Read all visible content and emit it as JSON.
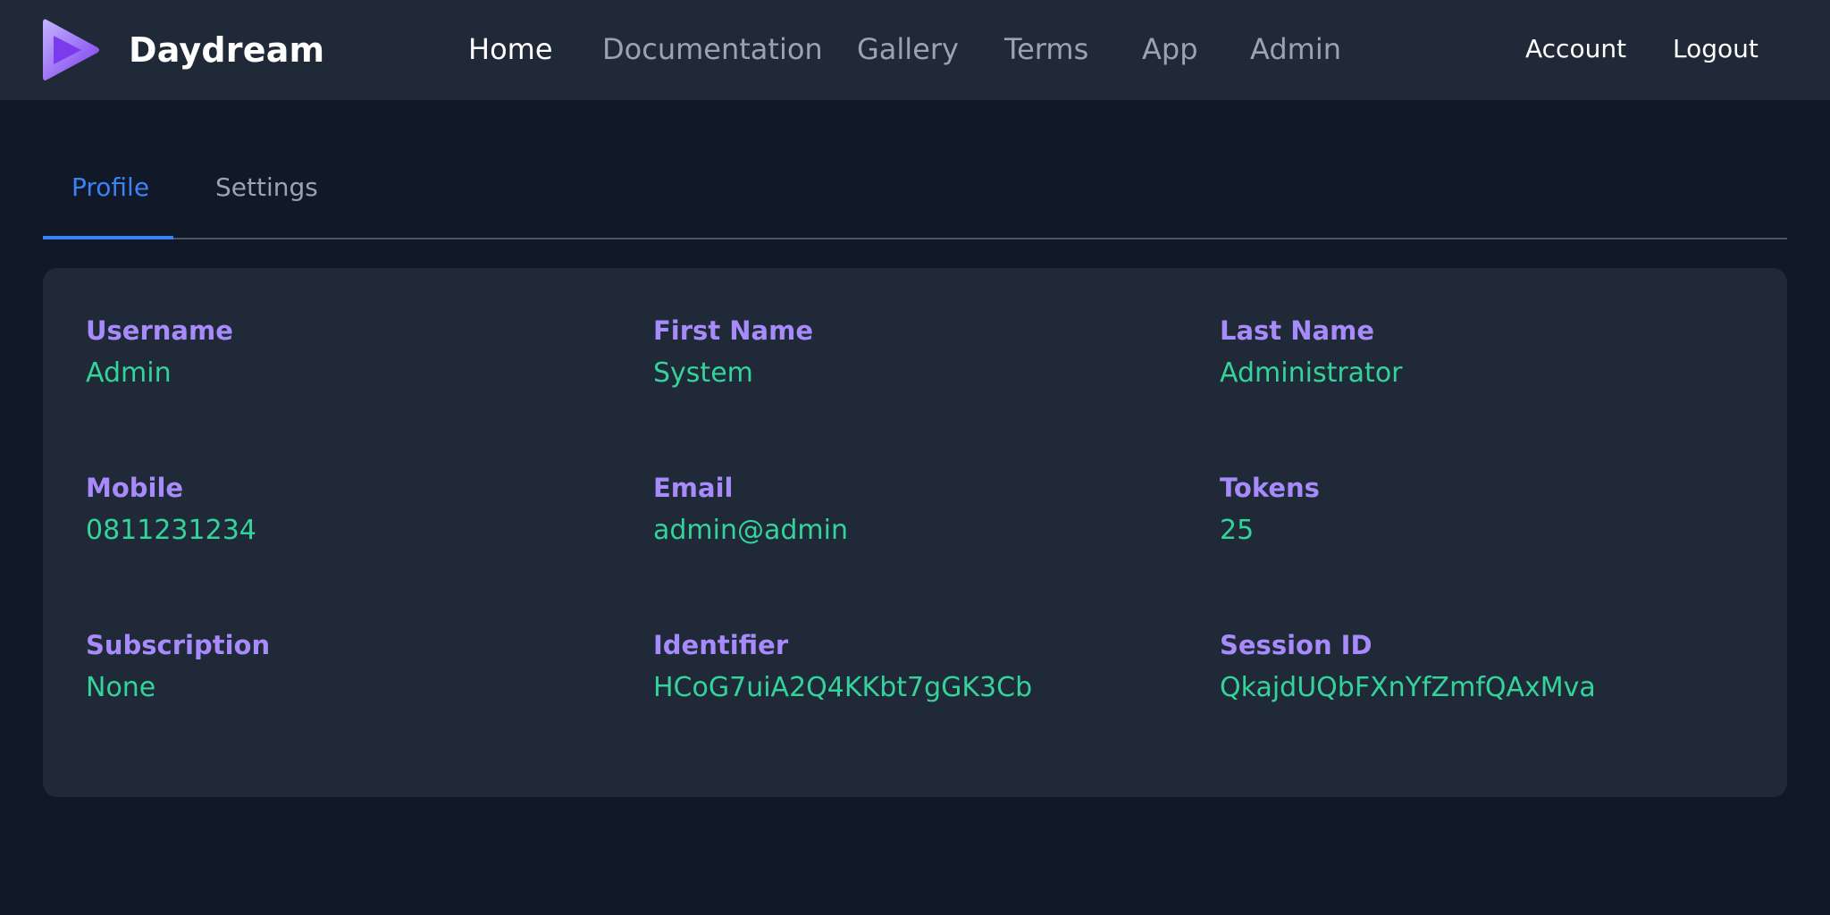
{
  "brand": {
    "name": "Daydream",
    "logo_icon": "play-triangle-icon",
    "logo_colors": [
      "#c4b5fd",
      "#7c3aed"
    ]
  },
  "nav": {
    "links": [
      "Home",
      "Documentation",
      "Gallery",
      "Terms",
      "App",
      "Admin"
    ],
    "active": "Home",
    "account": "Account",
    "logout": "Logout"
  },
  "tabs": {
    "items": [
      "Profile",
      "Settings"
    ],
    "active": "Profile"
  },
  "profile": {
    "fields": [
      {
        "label": "Username",
        "value": "Admin"
      },
      {
        "label": "First Name",
        "value": "System"
      },
      {
        "label": "Last Name",
        "value": "Administrator"
      },
      {
        "label": "Mobile",
        "value": "0811231234"
      },
      {
        "label": "Email",
        "value": "admin@admin"
      },
      {
        "label": "Tokens",
        "value": "25"
      },
      {
        "label": "Subscription",
        "value": "None"
      },
      {
        "label": "Identifier",
        "value": "HCoG7uiA2Q4KKbt7gGK3Cb"
      },
      {
        "label": "Session ID",
        "value": "QkajdUQbFXnYfZmfQAxMva"
      }
    ]
  },
  "colors": {
    "page_bg": "#111827",
    "nav_bg": "#1f2937",
    "card_bg": "#1f2937",
    "label": "#a78bfa",
    "value": "#34d399",
    "accent": "#3b82f6",
    "muted": "#9ca3af"
  }
}
